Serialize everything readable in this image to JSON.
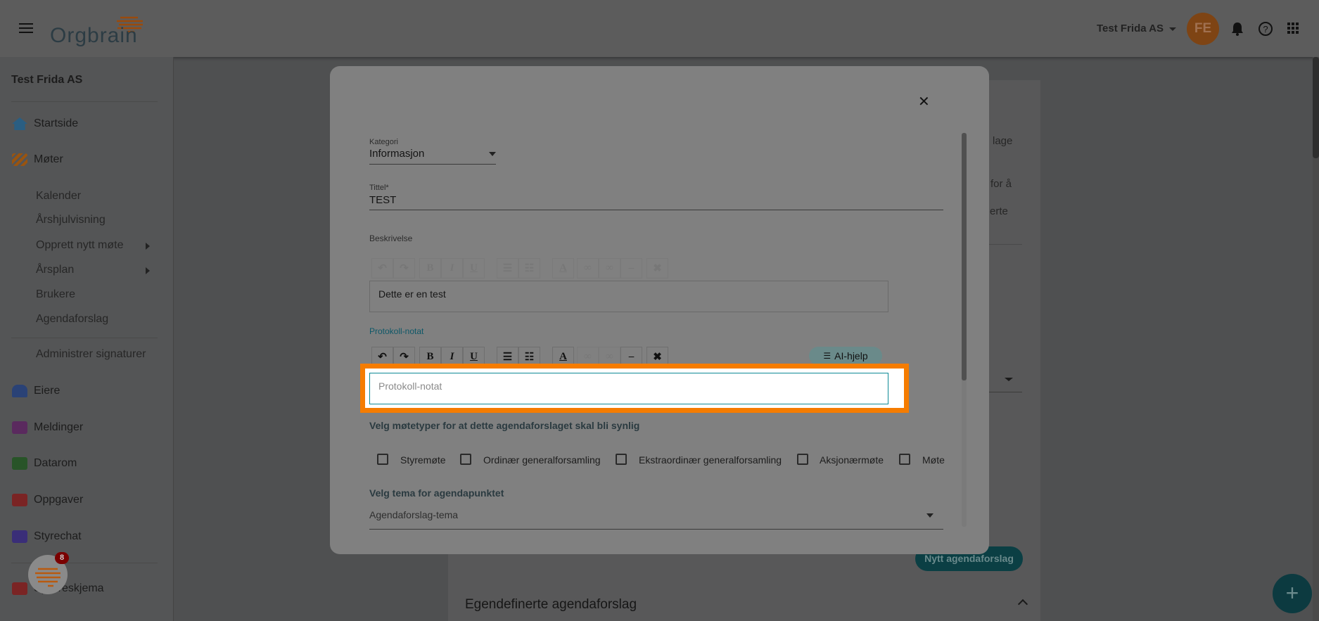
{
  "header": {
    "logo": "Orgbrain",
    "company_selector": "Test Frida AS",
    "avatar_initials": "FE",
    "icons": [
      "menu-icon",
      "bell-icon",
      "help-icon",
      "apps-icon"
    ]
  },
  "sidebar": {
    "org_name": "Test Frida AS",
    "items": [
      {
        "label": "Startside",
        "icon": "home-icon",
        "color": "#2a6e9a"
      },
      {
        "label": "Møter",
        "icon": "gavel-icon",
        "color": "#b8620f"
      },
      {
        "label": "Kalender"
      },
      {
        "label": "Årshjulvisning"
      },
      {
        "label": "Opprett nytt møte"
      },
      {
        "label": "Årsplan"
      },
      {
        "label": "Brukere"
      },
      {
        "label": "Agendaforslag"
      },
      {
        "label": "Administrer signaturer"
      },
      {
        "label": "Eiere",
        "icon": "people-icon",
        "color": "#2a4e8a"
      },
      {
        "label": "Meldinger",
        "icon": "message-alert-icon",
        "color": "#6a2a6a"
      },
      {
        "label": "Datarom",
        "icon": "folder-icon",
        "color": "#2a5e2a"
      },
      {
        "label": "Oppgaver",
        "icon": "task-icon",
        "color": "#8a2020"
      },
      {
        "label": "Styrechat",
        "icon": "chat-icon",
        "color": "#3e2e8a"
      },
      {
        "label": "Spørreskjema",
        "icon": "survey-icon",
        "color": "#8a2020"
      }
    ],
    "chat_badge": "8"
  },
  "background": {
    "fragments": [
      "lage",
      "for å",
      "erte"
    ],
    "new_button": "Nytt agendaforslag",
    "section_title": "Egendefinerte agendaforslag"
  },
  "modal": {
    "kategori_label": "Kategori",
    "kategori_value": "Informasjon",
    "tittel_label": "Tittel*",
    "tittel_value": "TEST",
    "beskrivelse_label": "Beskrivelse",
    "beskrivelse_value": "Dette er en test",
    "protokoll_label": "Protokoll-notat",
    "protokoll_placeholder": "Protokoll-notat",
    "ai_button": "AI-hjelp",
    "toolbar": [
      "undo",
      "redo",
      "B",
      "I",
      "U",
      "bullet-list",
      "numbered-list",
      "A",
      "link",
      "unlink",
      "hr",
      "clear"
    ],
    "meeting_types_heading": "Velg møtetyper for at dette agendaforslaget skal bli synlig",
    "meeting_types": [
      "Styremøte",
      "Ordinær generalforsamling",
      "Ekstraordinær generalforsamling",
      "Aksjonærmøte",
      "Møte"
    ],
    "theme_heading": "Velg tema for agendapunktet",
    "theme_placeholder": "Agendaforslag-tema"
  },
  "colors": {
    "highlight": "#f57c00",
    "teal": "#0b4a50",
    "accent_label": "#0e6070"
  }
}
